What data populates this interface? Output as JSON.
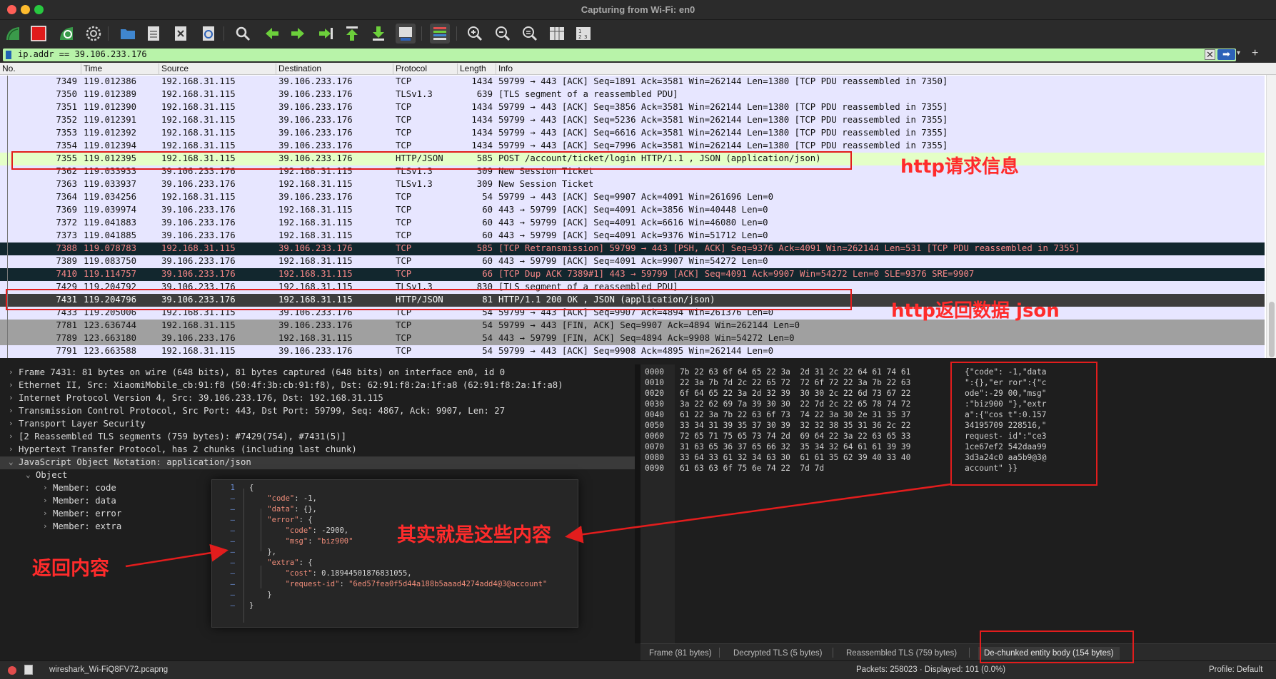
{
  "window": {
    "title": "Capturing from Wi-Fi: en0"
  },
  "toolbar": {
    "buttons": [
      "start-capture-icon",
      "stop-capture-icon",
      "restart-capture-icon",
      "capture-options-icon",
      "open-file-icon",
      "save-file-icon",
      "close-file-icon",
      "reload-file-icon",
      "find-packet-icon",
      "go-back-icon",
      "go-forward-icon",
      "go-to-packet-icon",
      "go-first-icon",
      "go-last-icon",
      "autoscroll-icon",
      "colorize-icon",
      "zoom-in-icon",
      "zoom-out-icon",
      "zoom-normal-icon",
      "resize-columns-icon",
      "expand-subtrees-icon"
    ]
  },
  "filter": {
    "value": "ip.addr == 39.106.233.176",
    "clear_glyph": "✕",
    "apply_glyph": "➡",
    "dropdown_glyph": "▾",
    "add_glyph": "+"
  },
  "packet_list": {
    "columns": [
      "No.",
      "Time",
      "Source",
      "Destination",
      "Protocol",
      "Length",
      "Info"
    ],
    "rows": [
      {
        "no": "7349",
        "time": "119.012386",
        "src": "192.168.31.115",
        "dst": "39.106.233.176",
        "proto": "TCP",
        "len": "1434",
        "info": "59799 → 443 [ACK] Seq=1891 Ack=3581 Win=262144 Len=1380 [TCP PDU reassembled in 7350]",
        "style": "tcp"
      },
      {
        "no": "7350",
        "time": "119.012389",
        "src": "192.168.31.115",
        "dst": "39.106.233.176",
        "proto": "TLSv1.3",
        "len": "639",
        "info": "[TLS segment of a reassembled PDU]",
        "style": "tls"
      },
      {
        "no": "7351",
        "time": "119.012390",
        "src": "192.168.31.115",
        "dst": "39.106.233.176",
        "proto": "TCP",
        "len": "1434",
        "info": "59799 → 443 [ACK] Seq=3856 Ack=3581 Win=262144 Len=1380 [TCP PDU reassembled in 7355]",
        "style": "tcp"
      },
      {
        "no": "7352",
        "time": "119.012391",
        "src": "192.168.31.115",
        "dst": "39.106.233.176",
        "proto": "TCP",
        "len": "1434",
        "info": "59799 → 443 [ACK] Seq=5236 Ack=3581 Win=262144 Len=1380 [TCP PDU reassembled in 7355]",
        "style": "tcp"
      },
      {
        "no": "7353",
        "time": "119.012392",
        "src": "192.168.31.115",
        "dst": "39.106.233.176",
        "proto": "TCP",
        "len": "1434",
        "info": "59799 → 443 [ACK] Seq=6616 Ack=3581 Win=262144 Len=1380 [TCP PDU reassembled in 7355]",
        "style": "tcp"
      },
      {
        "no": "7354",
        "time": "119.012394",
        "src": "192.168.31.115",
        "dst": "39.106.233.176",
        "proto": "TCP",
        "len": "1434",
        "info": "59799 → 443 [ACK] Seq=7996 Ack=3581 Win=262144 Len=1380 [TCP PDU reassembled in 7355]",
        "style": "tcp"
      },
      {
        "no": "7355",
        "time": "119.012395",
        "src": "192.168.31.115",
        "dst": "39.106.233.176",
        "proto": "HTTP/JSON",
        "len": "585",
        "info": "POST /account/ticket/login HTTP/1.1 , JSON (application/json)",
        "style": "http"
      },
      {
        "no": "7362",
        "time": "119.033933",
        "src": "39.106.233.176",
        "dst": "192.168.31.115",
        "proto": "TLSv1.3",
        "len": "309",
        "info": "New Session Ticket",
        "style": "tls"
      },
      {
        "no": "7363",
        "time": "119.033937",
        "src": "39.106.233.176",
        "dst": "192.168.31.115",
        "proto": "TLSv1.3",
        "len": "309",
        "info": "New Session Ticket",
        "style": "tls"
      },
      {
        "no": "7364",
        "time": "119.034256",
        "src": "192.168.31.115",
        "dst": "39.106.233.176",
        "proto": "TCP",
        "len": "54",
        "info": "59799 → 443 [ACK] Seq=9907 Ack=4091 Win=261696 Len=0",
        "style": "tcp"
      },
      {
        "no": "7369",
        "time": "119.039974",
        "src": "39.106.233.176",
        "dst": "192.168.31.115",
        "proto": "TCP",
        "len": "60",
        "info": "443 → 59799 [ACK] Seq=4091 Ack=3856 Win=40448 Len=0",
        "style": "tcp"
      },
      {
        "no": "7372",
        "time": "119.041883",
        "src": "39.106.233.176",
        "dst": "192.168.31.115",
        "proto": "TCP",
        "len": "60",
        "info": "443 → 59799 [ACK] Seq=4091 Ack=6616 Win=46080 Len=0",
        "style": "tcp"
      },
      {
        "no": "7373",
        "time": "119.041885",
        "src": "39.106.233.176",
        "dst": "192.168.31.115",
        "proto": "TCP",
        "len": "60",
        "info": "443 → 59799 [ACK] Seq=4091 Ack=9376 Win=51712 Len=0",
        "style": "tcp"
      },
      {
        "no": "7388",
        "time": "119.078783",
        "src": "192.168.31.115",
        "dst": "39.106.233.176",
        "proto": "TCP",
        "len": "585",
        "info": "[TCP Retransmission] 59799 → 443 [PSH, ACK] Seq=9376 Ack=4091 Win=262144 Len=531 [TCP PDU reassembled in 7355]",
        "style": "bad"
      },
      {
        "no": "7389",
        "time": "119.083750",
        "src": "39.106.233.176",
        "dst": "192.168.31.115",
        "proto": "TCP",
        "len": "60",
        "info": "443 → 59799 [ACK] Seq=4091 Ack=9907 Win=54272 Len=0",
        "style": "tcp"
      },
      {
        "no": "7410",
        "time": "119.114757",
        "src": "39.106.233.176",
        "dst": "192.168.31.115",
        "proto": "TCP",
        "len": "66",
        "info": "[TCP Dup ACK 7389#1] 443 → 59799 [ACK] Seq=4091 Ack=9907 Win=54272 Len=0 SLE=9376 SRE=9907",
        "style": "bad"
      },
      {
        "no": "7429",
        "time": "119.204792",
        "src": "39.106.233.176",
        "dst": "192.168.31.115",
        "proto": "TLSv1.3",
        "len": "830",
        "info": "[TLS segment of a reassembled PDU]",
        "style": "tls"
      },
      {
        "no": "7431",
        "time": "119.204796",
        "src": "39.106.233.176",
        "dst": "192.168.31.115",
        "proto": "HTTP/JSON",
        "len": "81",
        "info": "HTTP/1.1 200 OK , JSON (application/json)",
        "style": "sel"
      },
      {
        "no": "7433",
        "time": "119.205006",
        "src": "192.168.31.115",
        "dst": "39.106.233.176",
        "proto": "TCP",
        "len": "54",
        "info": "59799 → 443 [ACK] Seq=9907 Ack=4894 Win=261376 Len=0",
        "style": "tcp"
      },
      {
        "no": "7781",
        "time": "123.636744",
        "src": "192.168.31.115",
        "dst": "39.106.233.176",
        "proto": "TCP",
        "len": "54",
        "info": "59799 → 443 [FIN, ACK] Seq=9907 Ack=4894 Win=262144 Len=0",
        "style": "fin"
      },
      {
        "no": "7789",
        "time": "123.663180",
        "src": "39.106.233.176",
        "dst": "192.168.31.115",
        "proto": "TCP",
        "len": "54",
        "info": "443 → 59799 [FIN, ACK] Seq=4894 Ack=9908 Win=54272 Len=0",
        "style": "fin"
      },
      {
        "no": "7791",
        "time": "123.663588",
        "src": "192.168.31.115",
        "dst": "39.106.233.176",
        "proto": "TCP",
        "len": "54",
        "info": "59799 → 443 [ACK] Seq=9908 Ack=4895 Win=262144 Len=0",
        "style": "tcp"
      }
    ]
  },
  "details": {
    "rows": [
      {
        "caret": "›",
        "indent": 0,
        "text": "Frame 7431: 81 bytes on wire (648 bits), 81 bytes captured (648 bits) on interface en0, id 0"
      },
      {
        "caret": "›",
        "indent": 0,
        "text": "Ethernet II, Src: XiaomiMobile_cb:91:f8 (50:4f:3b:cb:91:f8), Dst: 62:91:f8:2a:1f:a8 (62:91:f8:2a:1f:a8)"
      },
      {
        "caret": "›",
        "indent": 0,
        "text": "Internet Protocol Version 4, Src: 39.106.233.176, Dst: 192.168.31.115"
      },
      {
        "caret": "›",
        "indent": 0,
        "text": "Transmission Control Protocol, Src Port: 443, Dst Port: 59799, Seq: 4867, Ack: 9907, Len: 27"
      },
      {
        "caret": "›",
        "indent": 0,
        "text": "Transport Layer Security"
      },
      {
        "caret": "›",
        "indent": 0,
        "text": "[2 Reassembled TLS segments (759 bytes): #7429(754), #7431(5)]"
      },
      {
        "caret": "›",
        "indent": 0,
        "text": "Hypertext Transfer Protocol, has 2 chunks (including last chunk)"
      },
      {
        "caret": "⌄",
        "indent": 0,
        "text": "JavaScript Object Notation: application/json",
        "selected": true
      },
      {
        "caret": "⌄",
        "indent": 1,
        "text": "Object"
      },
      {
        "caret": "›",
        "indent": 2,
        "text": "Member: code"
      },
      {
        "caret": "›",
        "indent": 2,
        "text": "Member: data"
      },
      {
        "caret": "›",
        "indent": 2,
        "text": "Member: error"
      },
      {
        "caret": "›",
        "indent": 2,
        "text": "Member: extra"
      }
    ]
  },
  "json_view": {
    "lines": [
      {
        "ln": "1",
        "text": "{"
      },
      {
        "ln": "–",
        "text": "    \"code\": -1,"
      },
      {
        "ln": "–",
        "text": "    \"data\": {},"
      },
      {
        "ln": "–",
        "text": "    \"error\": {"
      },
      {
        "ln": "–",
        "text": "        \"code\": -2900,"
      },
      {
        "ln": "–",
        "text": "        \"msg\": \"biz900\""
      },
      {
        "ln": "–",
        "text": "    },"
      },
      {
        "ln": "–",
        "text": "    \"extra\": {"
      },
      {
        "ln": "–",
        "text": "        \"cost\": 0.18944501876831055,"
      },
      {
        "ln": "–",
        "text": "        \"request-id\": \"6ed57fea0f5d44a188b5aaad4274add4@3@account\""
      },
      {
        "ln": "–",
        "text": "    }"
      },
      {
        "ln": "–",
        "text": "}"
      }
    ]
  },
  "hex": {
    "rows": [
      {
        "off": "0000",
        "bytes": "7b 22 63 6f 64 65 22 3a  2d 31 2c 22 64 61 74 61",
        "ascii": "{\"code\": -1,\"data"
      },
      {
        "off": "0010",
        "bytes": "22 3a 7b 7d 2c 22 65 72  72 6f 72 22 3a 7b 22 63",
        "ascii": "\":{},\"er ror\":{\"c"
      },
      {
        "off": "0020",
        "bytes": "6f 64 65 22 3a 2d 32 39  30 30 2c 22 6d 73 67 22",
        "ascii": "ode\":-29 00,\"msg\""
      },
      {
        "off": "0030",
        "bytes": "3a 22 62 69 7a 39 30 30  22 7d 2c 22 65 78 74 72",
        "ascii": ":\"biz900 \"},\"extr"
      },
      {
        "off": "0040",
        "bytes": "61 22 3a 7b 22 63 6f 73  74 22 3a 30 2e 31 35 37",
        "ascii": "a\":{\"cos t\":0.157"
      },
      {
        "off": "0050",
        "bytes": "33 34 31 39 35 37 30 39  32 32 38 35 31 36 2c 22",
        "ascii": "34195709 228516,\""
      },
      {
        "off": "0060",
        "bytes": "72 65 71 75 65 73 74 2d  69 64 22 3a 22 63 65 33",
        "ascii": "request- id\":\"ce3"
      },
      {
        "off": "0070",
        "bytes": "31 63 65 36 37 65 66 32  35 34 32 64 61 61 39 39",
        "ascii": "1ce67ef2 542daa99"
      },
      {
        "off": "0080",
        "bytes": "33 64 33 61 32 34 63 30  61 61 35 62 39 40 33 40",
        "ascii": "3d3a24c0 aa5b9@3@"
      },
      {
        "off": "0090",
        "bytes": "61 63 63 6f 75 6e 74 22  7d 7d",
        "ascii": "account\" }}"
      }
    ]
  },
  "bytes_tabs": [
    "Frame (81 bytes)",
    "Decrypted TLS (5 bytes)",
    "Reassembled TLS (759 bytes)",
    "De-chunked entity body (154 bytes)"
  ],
  "status": {
    "file": "wireshark_Wi-FiQ8FV72.pcapng",
    "packets": "Packets: 258023 · Displayed: 101 (0.0%)",
    "profile": "Profile: Default"
  },
  "annotations": {
    "request": "http请求信息",
    "response": "http返回数据 json",
    "content": "其实就是这些内容",
    "returned": "返回内容"
  },
  "colors": {
    "accent_red": "#e21d1d",
    "filter_bg": "#b8f3a9",
    "http_row": "#e4ffc7",
    "tcp_row": "#e7e6ff",
    "bad_row": "#12272e"
  }
}
